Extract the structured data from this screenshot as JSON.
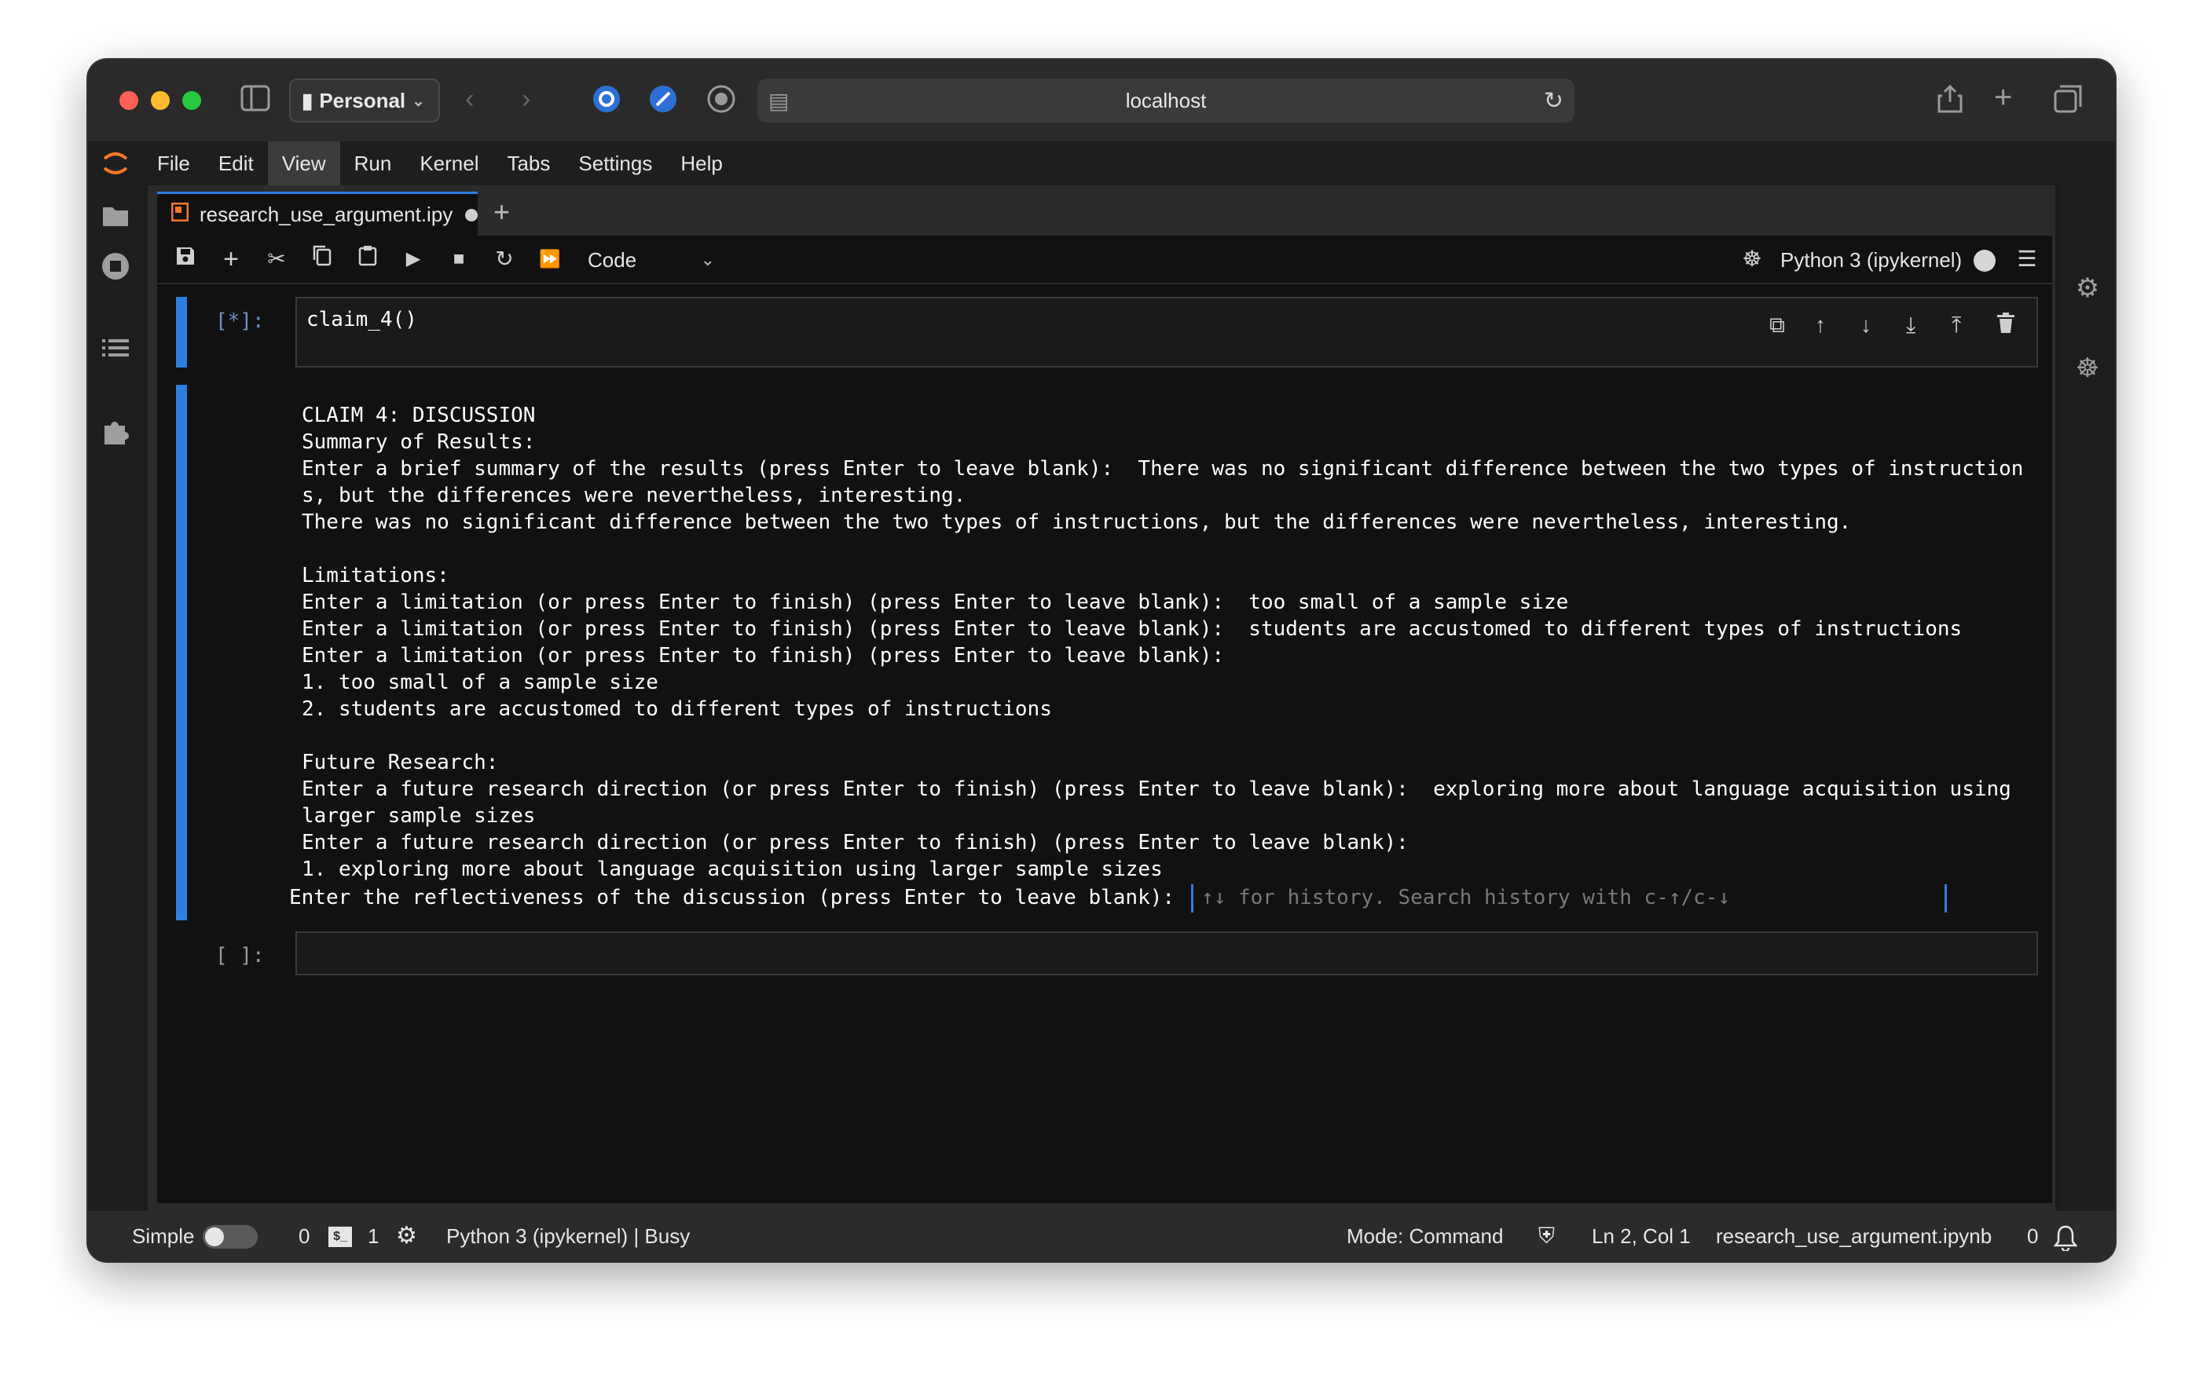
{
  "browser": {
    "profile_label": "Personal",
    "url": "localhost",
    "icons": [
      "sidebar-icon",
      "back-icon",
      "forward-icon",
      "extension-icon",
      "compass-icon",
      "record-icon",
      "page-icon",
      "reload-icon",
      "share-icon",
      "new-tab-icon",
      "tabs-icon"
    ]
  },
  "menubar": {
    "items": [
      "File",
      "Edit",
      "View",
      "Run",
      "Kernel",
      "Tabs",
      "Settings",
      "Help"
    ],
    "active": "View"
  },
  "tab": {
    "title": "research_use_argument.ipy"
  },
  "toolbar": {
    "cell_type": "Code",
    "kernel": "Python 3 (ipykernel)"
  },
  "cells": [
    {
      "prompt": "[*]:",
      "source": "claim_4()",
      "output": [
        "CLAIM 4: DISCUSSION",
        "Summary of Results:",
        "Enter a brief summary of the results (press Enter to leave blank):  There was no significant difference between the two types of instruction",
        "s, but the differences were nevertheless, interesting.",
        "There was no significant difference between the two types of instructions, but the differences were nevertheless, interesting.",
        "",
        "Limitations:",
        "Enter a limitation (or press Enter to finish) (press Enter to leave blank):  too small of a sample size",
        "Enter a limitation (or press Enter to finish) (press Enter to leave blank):  students are accustomed to different types of instructions",
        "Enter a limitation (or press Enter to finish) (press Enter to leave blank):",
        "1. too small of a sample size",
        "2. students are accustomed to different types of instructions",
        "",
        "Future Research:",
        "Enter a future research direction (or press Enter to finish) (press Enter to leave blank):  exploring more about language acquisition using",
        "larger sample sizes",
        "Enter a future research direction (or press Enter to finish) (press Enter to leave blank):",
        "1. exploring more about language acquisition using larger sample sizes"
      ],
      "stdin_prompt": "Enter the reflectiveness of the discussion (press Enter to leave blank): ",
      "stdin_placeholder": "↑↓ for history. Search history with c-↑/c-↓"
    },
    {
      "prompt": "[ ]:",
      "source": ""
    }
  ],
  "statusbar": {
    "mode_label": "Simple",
    "terminals_count": "0",
    "kernels_count": "1",
    "kernel_status": "Python 3 (ipykernel) | Busy",
    "mode": "Mode: Command",
    "cursor": "Ln 2, Col 1",
    "filename": "research_use_argument.ipynb",
    "notifications": "0"
  }
}
